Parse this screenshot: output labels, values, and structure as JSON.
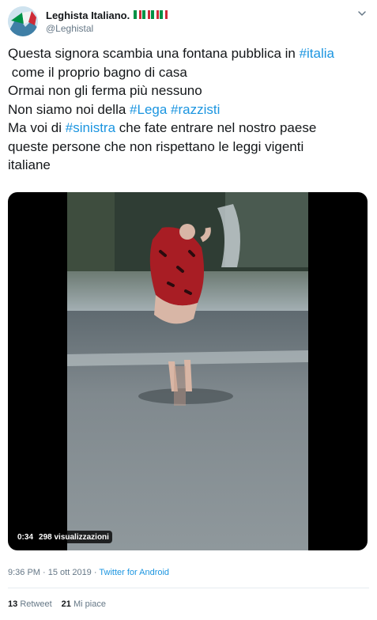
{
  "author": {
    "display_name": "Leghista Italiano.",
    "handle": "@Leghistal",
    "flag_colors": [
      "#009246",
      "#ffffff",
      "#ce2b37"
    ],
    "flag_count": 4
  },
  "tweet": {
    "lines": [
      [
        {
          "text": "Questa signora scambia una fontana pubblica in "
        },
        {
          "text": "#italia",
          "hashtag": true
        }
      ],
      [
        {
          "text": " come il proprio bagno di casa"
        }
      ],
      [
        {
          "text": "Ormai non gli ferma più nessuno"
        }
      ],
      [
        {
          "text": "Non siamo noi della "
        },
        {
          "text": "#Lega",
          "hashtag": true
        },
        {
          "text": " "
        },
        {
          "text": "#razzisti",
          "hashtag": true
        }
      ],
      [
        {
          "text": "Ma voi di "
        },
        {
          "text": "#sinistra",
          "hashtag": true
        },
        {
          "text": " che fate entrare nel nostro paese"
        }
      ],
      [
        {
          "text": "queste persone che non rispettano le leggi vigenti"
        }
      ],
      [
        {
          "text": "italiane"
        }
      ]
    ],
    "hashtag_color": "#1b95e0"
  },
  "video": {
    "duration": "0:34",
    "views": "298 visualizzazioni"
  },
  "meta": {
    "time": "9:36 PM",
    "separator": " · ",
    "date": "15 ott 2019",
    "source": "Twitter for Android"
  },
  "stats": {
    "retweets_count": "13",
    "retweets_label": "Retweet",
    "likes_count": "21",
    "likes_label": "Mi piace"
  },
  "icons": {
    "chevron": "chevron-down-icon"
  }
}
